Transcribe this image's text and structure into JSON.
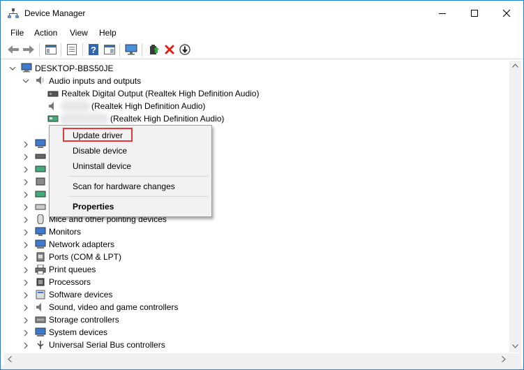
{
  "window": {
    "title": "Device Manager"
  },
  "menu": [
    "File",
    "Action",
    "View",
    "Help"
  ],
  "toolbar": [
    "back-icon",
    "forward-icon",
    "properties-sheet-icon",
    "console-tree-icon",
    "help-icon",
    "view-icon",
    "monitor-icon",
    "update-driver-icon",
    "uninstall-x-icon",
    "download-arrow-icon"
  ],
  "tree": {
    "root": "DESKTOP-BBS50JE",
    "audio_category": "Audio inputs and outputs",
    "audio_children": [
      "Realtek Digital Output (Realtek High Definition Audio)",
      "(Realtek High Definition Audio)",
      "(Realtek High Definition Audio)"
    ],
    "categories": [
      "Mice and other pointing devices",
      "Monitors",
      "Network adapters",
      "Ports (COM & LPT)",
      "Print queues",
      "Processors",
      "Software devices",
      "Sound, video and game controllers",
      "Storage controllers",
      "System devices",
      "Universal Serial Bus controllers"
    ]
  },
  "context_menu": {
    "update_driver": "Update driver",
    "disable_device": "Disable device",
    "uninstall_device": "Uninstall device",
    "scan_hardware": "Scan for hardware changes",
    "properties": "Properties"
  },
  "colors": {
    "accent": "#1883d7",
    "highlight_box": "#e53935",
    "uninstall_red": "#e0201b"
  }
}
